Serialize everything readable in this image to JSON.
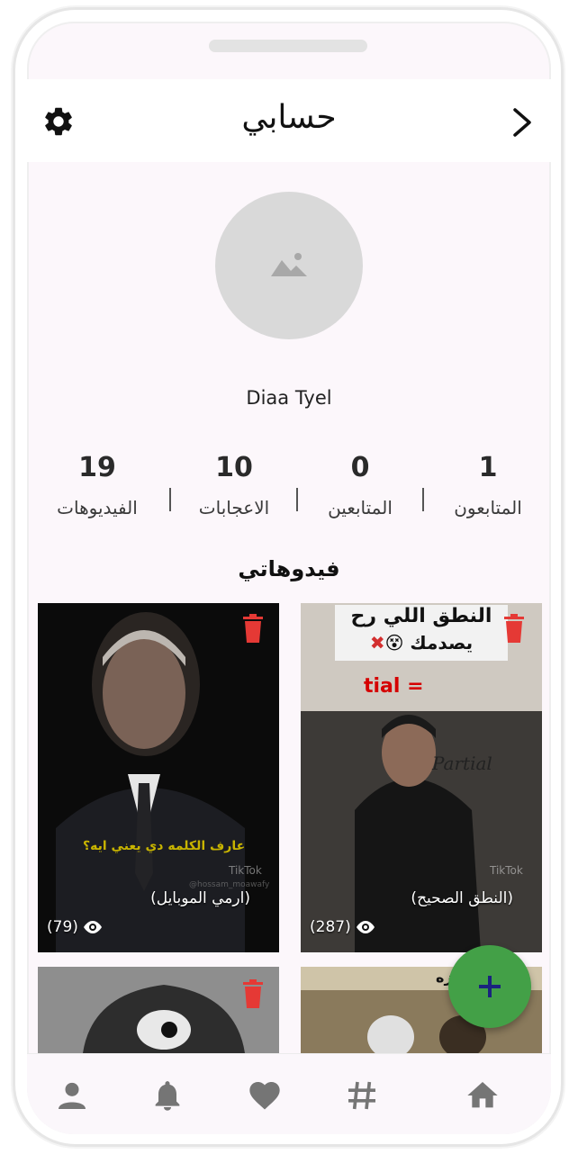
{
  "header": {
    "title": "حسابي"
  },
  "profile": {
    "username": "Diaa Tyel"
  },
  "stats": [
    {
      "value": "19",
      "label": "الفيديوهات"
    },
    {
      "value": "10",
      "label": "الاعجابات"
    },
    {
      "value": "0",
      "label": "المتابعين"
    },
    {
      "value": "1",
      "label": "المتابعون"
    }
  ],
  "section": {
    "title": "فيدوهاتي"
  },
  "videos": [
    {
      "caption": "(ارمي الموبايل)",
      "views": "(79)",
      "overlay_text": "عارف الكلمه دي يعني ايه؟",
      "watermark": "TikTok",
      "handle": "@hossam_moawafy"
    },
    {
      "caption": "(النطق الصحيح)",
      "views": "(287)",
      "overlay_title_1": "النطق اللي رح",
      "overlay_title_2": "يصدمك",
      "board_word": "tial =",
      "board_word2": "Partial",
      "watermark": "TikTok"
    },
    {
      "caption": "",
      "views": ""
    },
    {
      "caption": "",
      "views": "",
      "overlay_text": "ي عزه"
    }
  ],
  "fab": {
    "label": "+"
  },
  "nav": [
    "profile-icon",
    "bell-icon",
    "heart-icon",
    "hashtag-icon",
    "home-icon"
  ],
  "colors": {
    "accent": "#43a047",
    "delete": "#e53935",
    "fab_plus": "#1a237e"
  }
}
